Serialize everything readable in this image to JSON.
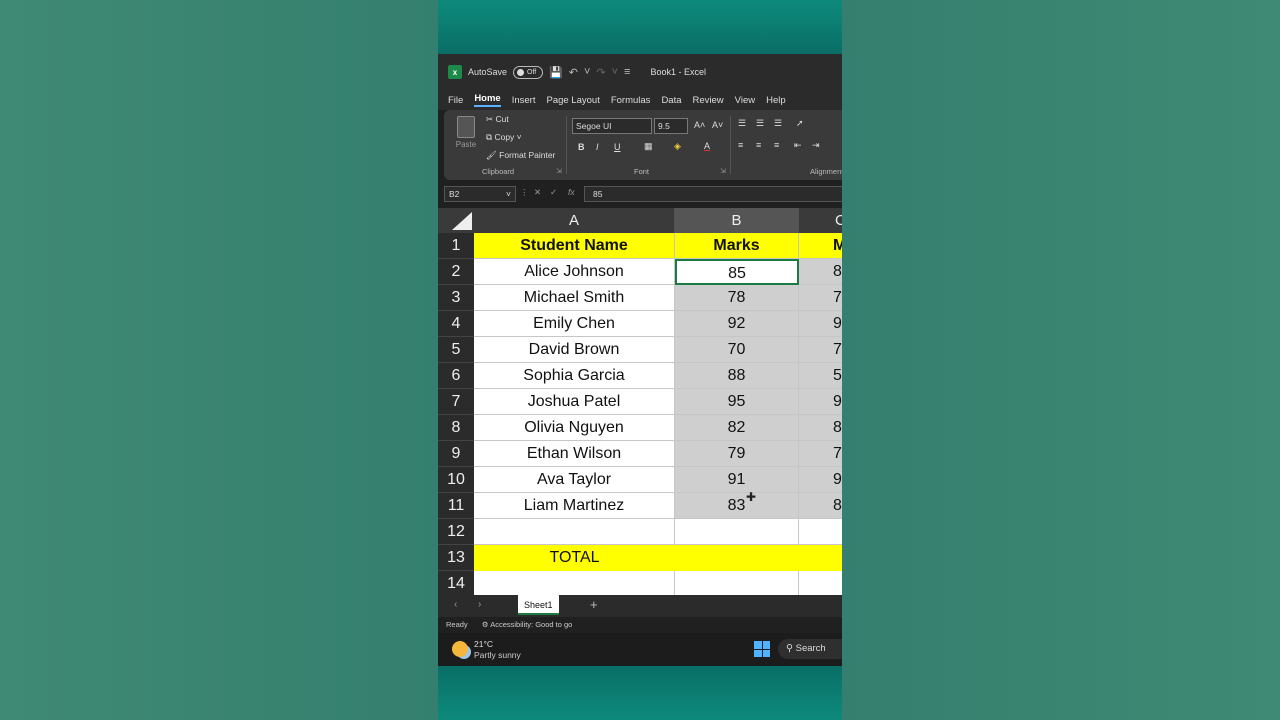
{
  "titlebar": {
    "autosave_label": "AutoSave",
    "autosave_state": "Off",
    "doc_title": "Book1 - Excel"
  },
  "menu": [
    "File",
    "Home",
    "Insert",
    "Page Layout",
    "Formulas",
    "Data",
    "Review",
    "View",
    "Help"
  ],
  "menu_active": "Home",
  "ribbon": {
    "paste": "Paste",
    "cut": "Cut",
    "copy": "Copy",
    "format_painter": "Format Painter",
    "clipboard_label": "Clipboard",
    "font_name": "Segoe UI",
    "font_size": "9.5",
    "font_label": "Font",
    "alignment_label": "Alignment",
    "bold": "B",
    "italic": "I",
    "underline": "U",
    "grow_font": "A˄",
    "shrink_font": "A˅",
    "font_color": "A"
  },
  "formula_bar": {
    "name_box": "B2",
    "fx": "fx",
    "value": "85"
  },
  "columns": [
    "A",
    "B",
    "C"
  ],
  "rows": [
    {
      "num": "1",
      "a": "Student Name",
      "b": "Marks",
      "c": "Ma"
    },
    {
      "num": "2",
      "a": "Alice Johnson",
      "b": "85",
      "c": "8"
    },
    {
      "num": "3",
      "a": "Michael Smith",
      "b": "78",
      "c": "7"
    },
    {
      "num": "4",
      "a": "Emily Chen",
      "b": "92",
      "c": "9"
    },
    {
      "num": "5",
      "a": "David Brown",
      "b": "70",
      "c": "7"
    },
    {
      "num": "6",
      "a": "Sophia Garcia",
      "b": "88",
      "c": "5"
    },
    {
      "num": "7",
      "a": "Joshua Patel",
      "b": "95",
      "c": "9"
    },
    {
      "num": "8",
      "a": "Olivia Nguyen",
      "b": "82",
      "c": "8"
    },
    {
      "num": "9",
      "a": "Ethan Wilson",
      "b": "79",
      "c": "7"
    },
    {
      "num": "10",
      "a": "Ava Taylor",
      "b": "91",
      "c": "9"
    },
    {
      "num": "11",
      "a": "Liam Martinez",
      "b": "83",
      "c": "8"
    },
    {
      "num": "12",
      "a": "",
      "b": "",
      "c": ""
    },
    {
      "num": "13",
      "a": "TOTAL",
      "b": "",
      "c": ""
    },
    {
      "num": "14",
      "a": "",
      "b": "",
      "c": ""
    }
  ],
  "sheet_tab": "Sheet1",
  "status": {
    "ready": "Ready",
    "accessibility": "Accessibility: Good to go"
  },
  "taskbar": {
    "temp": "21°C",
    "weather": "Partly sunny",
    "search": "Search"
  },
  "colors": {
    "header_fill": "#ffff00",
    "selection_fill": "#cfcfcf",
    "active_border": "#1d7a45"
  }
}
